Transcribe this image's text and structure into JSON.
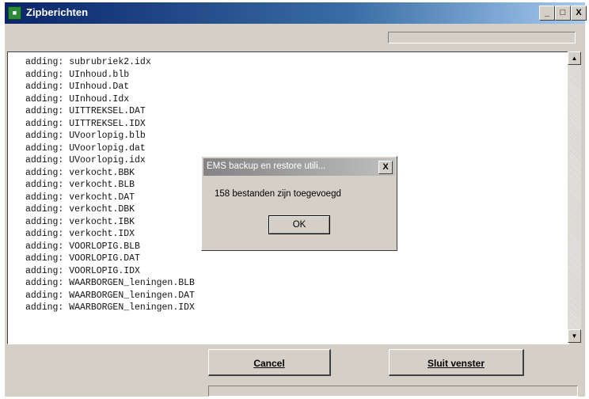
{
  "window": {
    "title": "Zipberichten",
    "minimize": "_",
    "maximize": "□",
    "close": "X"
  },
  "log": {
    "lines": [
      "adding: subrubriek2.idx",
      "adding: UInhoud.blb",
      "adding: UInhoud.Dat",
      "adding: UInhoud.Idx",
      "adding: UITTREKSEL.DAT",
      "adding: UITTREKSEL.IDX",
      "adding: UVoorlopig.blb",
      "adding: UVoorlopig.dat",
      "adding: UVoorlopig.idx",
      "adding: verkocht.BBK",
      "adding: verkocht.BLB",
      "adding: verkocht.DAT",
      "adding: verkocht.DBK",
      "adding: verkocht.IBK",
      "adding: verkocht.IDX",
      "adding: VOORLOPIG.BLB",
      "adding: VOORLOPIG.DAT",
      "adding: VOORLOPIG.IDX",
      "adding: WAARBORGEN_leningen.BLB",
      "adding: WAARBORGEN_leningen.DAT",
      "adding: WAARBORGEN_leningen.IDX"
    ]
  },
  "buttons": {
    "cancel": "Cancel",
    "close_window": "Sluit venster"
  },
  "dialog": {
    "title": "EMS backup en restore utili...",
    "message": "158 bestanden zijn toegevoegd",
    "ok": "OK",
    "close": "X"
  },
  "scrollbar": {
    "up": "▲",
    "down": "▼"
  },
  "colors": {
    "titlebar_active": "#0a246a",
    "titlebar_inactive": "#848284",
    "face": "#d4d0c8"
  }
}
